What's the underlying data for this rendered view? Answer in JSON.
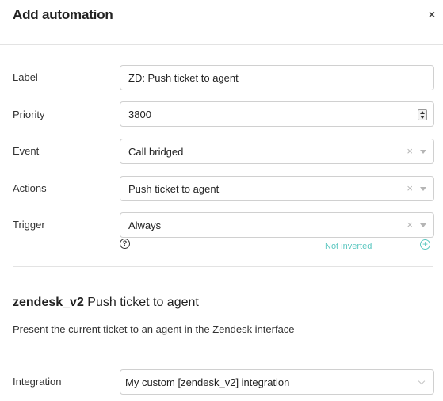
{
  "dialog": {
    "title": "Add automation",
    "close_label": "×"
  },
  "form": {
    "label": {
      "label": "Label",
      "value": "ZD: Push ticket to agent"
    },
    "priority": {
      "label": "Priority",
      "value": "3800"
    },
    "event": {
      "label": "Event",
      "value": "Call bridged",
      "clear": "×"
    },
    "actions": {
      "label": "Actions",
      "value": "Push ticket to agent",
      "clear": "×"
    },
    "trigger": {
      "label": "Trigger",
      "value": "Always",
      "clear": "×",
      "help": "?",
      "inverted_label": "Not inverted",
      "add": "+"
    }
  },
  "action_section": {
    "integration_type": "zendesk_v2",
    "action_name": "Push ticket to agent",
    "description": "Present the current ticket to an agent in the Zendesk interface",
    "integration": {
      "label": "Integration",
      "value": "My custom [zendesk_v2] integration"
    }
  }
}
